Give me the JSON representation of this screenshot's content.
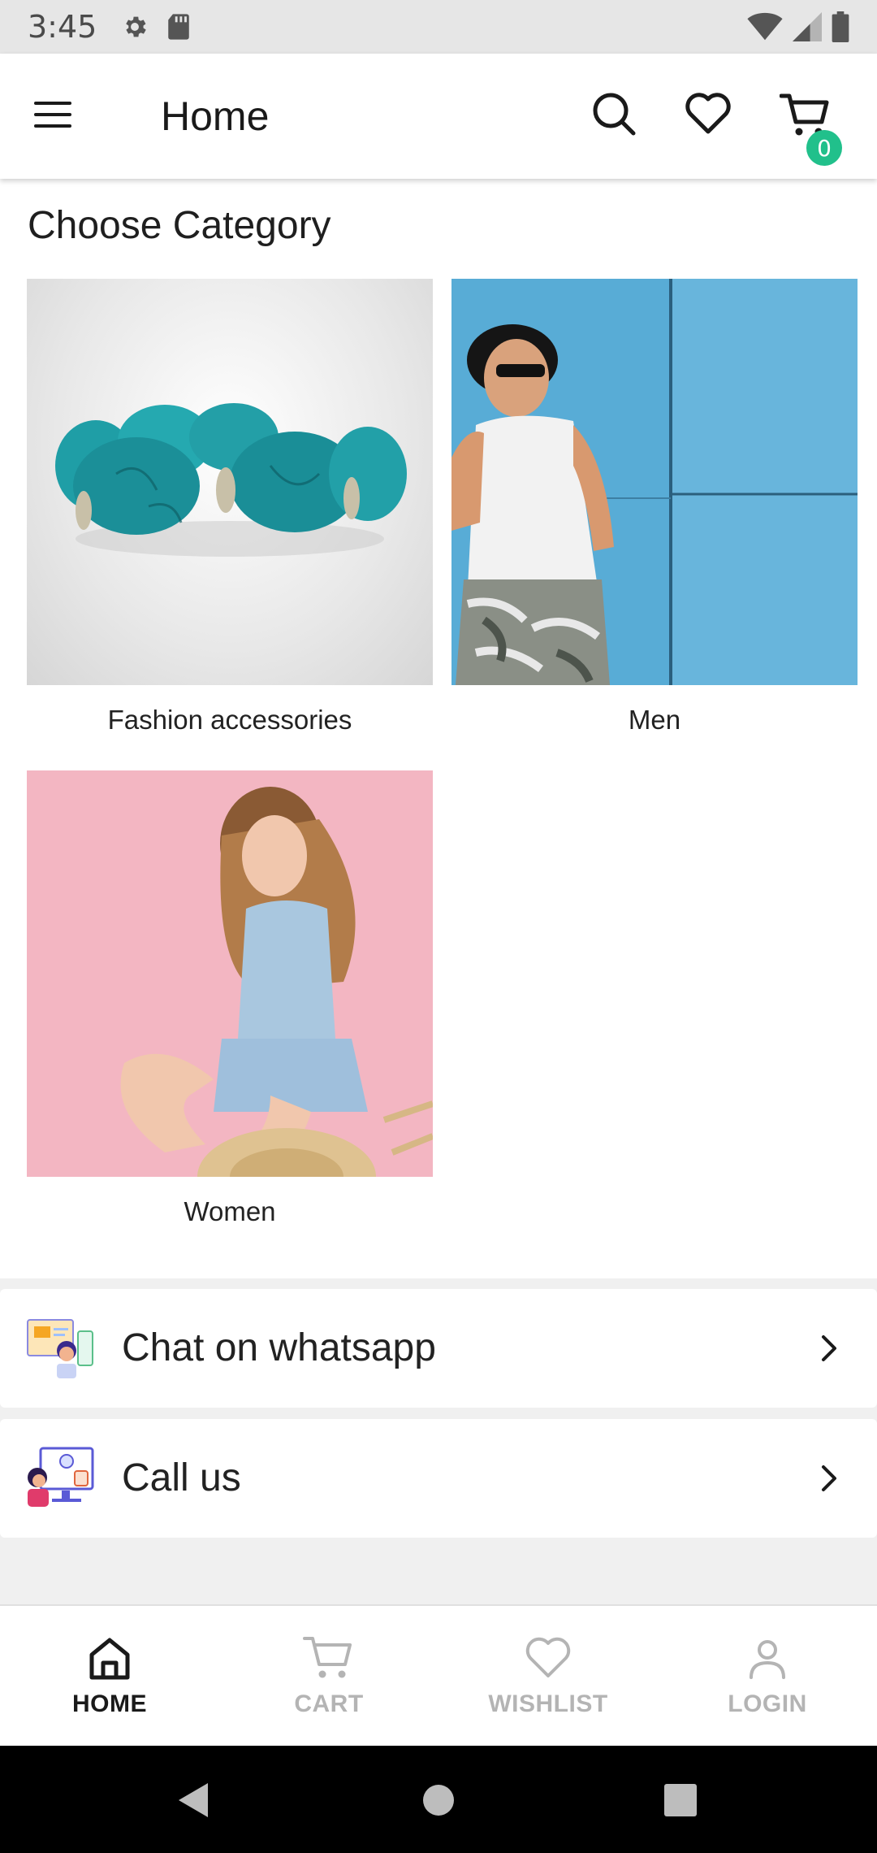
{
  "status_bar": {
    "time": "3:45"
  },
  "app_bar": {
    "title": "Home",
    "cart_count": "0"
  },
  "main": {
    "section_title": "Choose Category",
    "categories": [
      {
        "label": "Fashion accessories"
      },
      {
        "label": "Men"
      },
      {
        "label": "Women"
      }
    ]
  },
  "actions": [
    {
      "label": "Chat on whatsapp"
    },
    {
      "label": "Call us"
    }
  ],
  "bottom_nav": {
    "items": [
      {
        "label": "HOME",
        "active": true
      },
      {
        "label": "CART",
        "active": false
      },
      {
        "label": "WISHLIST",
        "active": false
      },
      {
        "label": "LOGIN",
        "active": false
      }
    ]
  },
  "colors": {
    "accent": "#21c08b",
    "status_bar": "#e6e6e6",
    "inactive_nav": "#b4b4b4"
  }
}
